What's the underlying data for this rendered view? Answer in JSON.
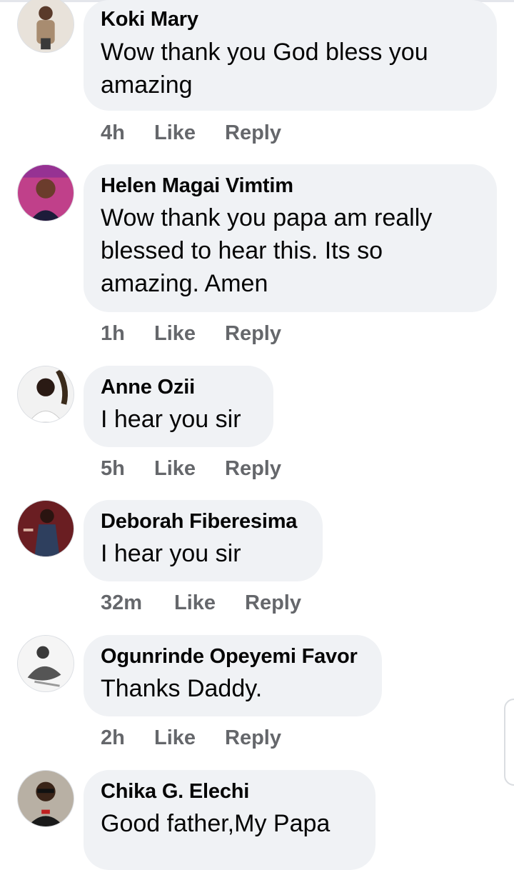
{
  "comments": [
    {
      "author": "Koki Mary",
      "lines": [
        "Wow thank you God bless you",
        "amazing"
      ],
      "time": "4h",
      "like": "Like",
      "reply": "Reply"
    },
    {
      "author": "Helen Magai Vimtim",
      "lines": [
        "Wow thank you papa am really",
        "blessed to hear this. Its so",
        "amazing. Amen"
      ],
      "time": "1h",
      "like": "Like",
      "reply": "Reply"
    },
    {
      "author": "Anne Ozii",
      "lines": [
        "I hear you sir"
      ],
      "time": "5h",
      "like": "Like",
      "reply": "Reply"
    },
    {
      "author": "Deborah Fiberesima",
      "lines": [
        "I hear you sir"
      ],
      "time": "32m",
      "like": "Like",
      "reply": "Reply"
    },
    {
      "author": "Ogunrinde Opeyemi Favor",
      "lines": [
        "Thanks Daddy."
      ],
      "time": "2h",
      "like": "Like",
      "reply": "Reply"
    },
    {
      "author": "Chika G. Elechi",
      "lines": [
        "Good father,My  Papa"
      ]
    }
  ],
  "colors": {
    "bubble": "#f0f2f5",
    "author": "#050505",
    "meta": "#65676b"
  }
}
